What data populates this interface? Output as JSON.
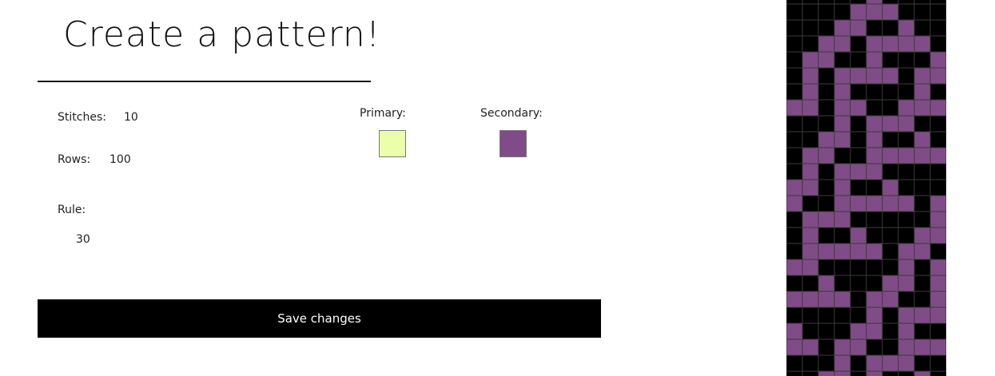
{
  "page": {
    "title": "Create a pattern!"
  },
  "form": {
    "stitches_label": "Stitches:",
    "stitches_value": "10",
    "rows_label": "Rows:",
    "rows_value": "100",
    "rule_label": "Rule:",
    "rule_value": "30",
    "primary_label": "Primary:",
    "primary_color": "#ebffab",
    "secondary_label": "Secondary:",
    "secondary_color": "#804c87",
    "save_label": "Save changes"
  },
  "pattern": {
    "cell_color": "#804c87",
    "background_color": "#000000",
    "grid_color": "#3a3a3a",
    "stitches": 10,
    "rows": 100,
    "rule": 30
  }
}
